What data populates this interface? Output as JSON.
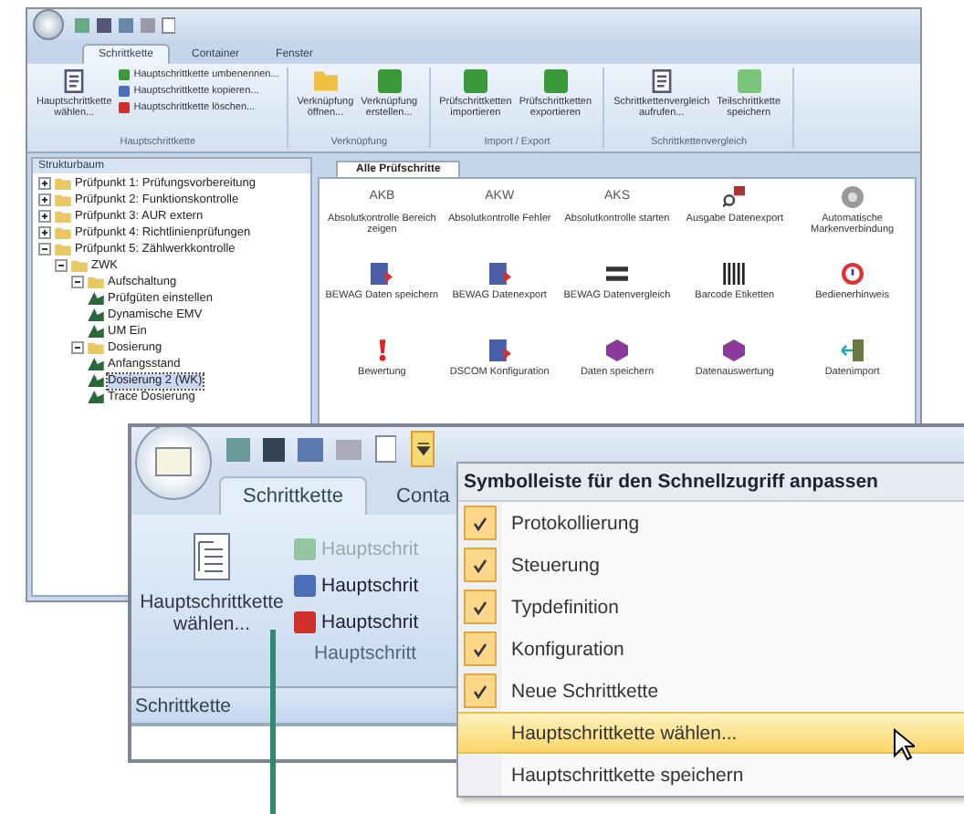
{
  "main_window": {
    "tabs": [
      {
        "label": "Schrittkette",
        "selected": true
      },
      {
        "label": "Container",
        "selected": false
      },
      {
        "label": "Fenster",
        "selected": false
      }
    ],
    "ribbon_groups": [
      {
        "label": "Hauptschrittkette",
        "buttons": [
          {
            "lines": [
              "Hauptschrittkette",
              "wählen..."
            ],
            "kind": "large"
          },
          {
            "lines": [
              "Hauptschrittkette umbenennen..."
            ],
            "kind": "small"
          },
          {
            "lines": [
              "Hauptschrittkette kopieren..."
            ],
            "kind": "small"
          },
          {
            "lines": [
              "Hauptschrittkette löschen..."
            ],
            "kind": "small"
          }
        ]
      },
      {
        "label": "Verknüpfung",
        "buttons": [
          {
            "lines": [
              "Verknüpfung",
              "öffnen..."
            ],
            "kind": "large"
          },
          {
            "lines": [
              "Verknüpfung",
              "erstellen..."
            ],
            "kind": "large"
          }
        ]
      },
      {
        "label": "Import / Export",
        "buttons": [
          {
            "lines": [
              "Prüfschrittketten",
              "importieren"
            ],
            "kind": "large"
          },
          {
            "lines": [
              "Prüfschrittketten",
              "exportieren"
            ],
            "kind": "large"
          }
        ]
      },
      {
        "label": "Schrittkettenvergleich",
        "buttons": [
          {
            "lines": [
              "Schrittkettenvergleich",
              "aufrufen..."
            ],
            "kind": "large"
          },
          {
            "lines": [
              "Teilschrittkette",
              "speichern"
            ],
            "kind": "large"
          }
        ]
      }
    ],
    "tree": {
      "title": "Strukturbaum",
      "items": [
        {
          "label": "Prüfpunkt 1: Prüfungsvorbereitung",
          "expanded": false,
          "selected": false
        },
        {
          "label": "Prüfpunkt 2: Funktionskontrolle",
          "expanded": false,
          "selected": false
        },
        {
          "label": "Prüfpunkt 3: AUR extern",
          "expanded": false,
          "selected": false
        },
        {
          "label": "Prüfpunkt 4: Richtlinienprüfungen",
          "expanded": false,
          "selected": false
        },
        {
          "label": "Prüfpunkt 5: Zählwerkkontrolle",
          "expanded": true,
          "selected": false,
          "children": [
            {
              "label": "ZWK",
              "expanded": true,
              "selected": false,
              "children": [
                {
                  "label": "Aufschaltung",
                  "expanded": true,
                  "selected": false,
                  "children": [
                    {
                      "label": "Prüfgüten einstellen",
                      "selected": false
                    },
                    {
                      "label": "Dynamische EMV",
                      "selected": false
                    },
                    {
                      "label": "UM Ein",
                      "selected": false
                    }
                  ]
                },
                {
                  "label": "Dosierung",
                  "expanded": true,
                  "selected": false,
                  "children": [
                    {
                      "label": "Anfangsstand",
                      "selected": false
                    },
                    {
                      "label": "Dosierung 2 (WK)",
                      "selected": true
                    },
                    {
                      "label": "Trace Dosierung",
                      "selected": false
                    }
                  ]
                }
              ]
            }
          ]
        }
      ]
    },
    "doc_tab": {
      "label": "Alle Prüfschritte"
    },
    "steps": [
      {
        "label": "Absolutkontrolle Bereich zeigen",
        "kind": "text",
        "icon_text": "AKB"
      },
      {
        "label": "Absolutkontrolle Fehler",
        "kind": "text",
        "icon_text": "AKW"
      },
      {
        "label": "Absolutkontrolle starten",
        "kind": "text",
        "icon_text": "AKS"
      },
      {
        "label": "Ausgabe Datenexport",
        "kind": "search"
      },
      {
        "label": "Automatische Markenverbindung",
        "kind": "gear"
      },
      {
        "label": "BEWAG Daten speichern",
        "kind": "window"
      },
      {
        "label": "BEWAG Datenexport",
        "kind": "window"
      },
      {
        "label": "BEWAG Datenvergleich",
        "kind": "equals"
      },
      {
        "label": "Barcode Etiketten",
        "kind": "barcode"
      },
      {
        "label": "Bedienerhinweis",
        "kind": "alert"
      },
      {
        "label": "Bewertung",
        "kind": "exclaim"
      },
      {
        "label": "DSCOM Konfiguration",
        "kind": "window"
      },
      {
        "label": "Daten speichern",
        "kind": "box"
      },
      {
        "label": "Datenauswertung",
        "kind": "box"
      },
      {
        "label": "Datenimport",
        "kind": "door"
      }
    ]
  },
  "callout": {
    "tabs": [
      {
        "label": "Schrittkette",
        "selected": true
      },
      {
        "label": "Conta",
        "selected": false
      }
    ],
    "large_button": {
      "lines": [
        "Hauptschrittkette",
        "wählen..."
      ]
    },
    "small_buttons": [
      {
        "label": "Hauptschrit",
        "disabled": true
      },
      {
        "label": "Hauptschrit",
        "disabled": false
      },
      {
        "label": "Hauptschrit",
        "disabled": false
      }
    ],
    "group_label": "Hauptschritt",
    "panel_title": "Schrittkette"
  },
  "menu": {
    "title": "Symbolleiste für den Schnellzugriff anpassen",
    "items": [
      {
        "label": "Protokollierung",
        "checked": true,
        "selected": false
      },
      {
        "label": "Steuerung",
        "checked": true,
        "selected": false
      },
      {
        "label": "Typdefinition",
        "checked": true,
        "selected": false
      },
      {
        "label": "Konfiguration",
        "checked": true,
        "selected": false
      },
      {
        "label": "Neue Schrittkette",
        "checked": true,
        "selected": false
      },
      {
        "label": "Hauptschrittkette wählen...",
        "checked": false,
        "selected": true
      },
      {
        "label": "Hauptschrittkette speichern",
        "checked": false,
        "selected": false
      }
    ]
  }
}
